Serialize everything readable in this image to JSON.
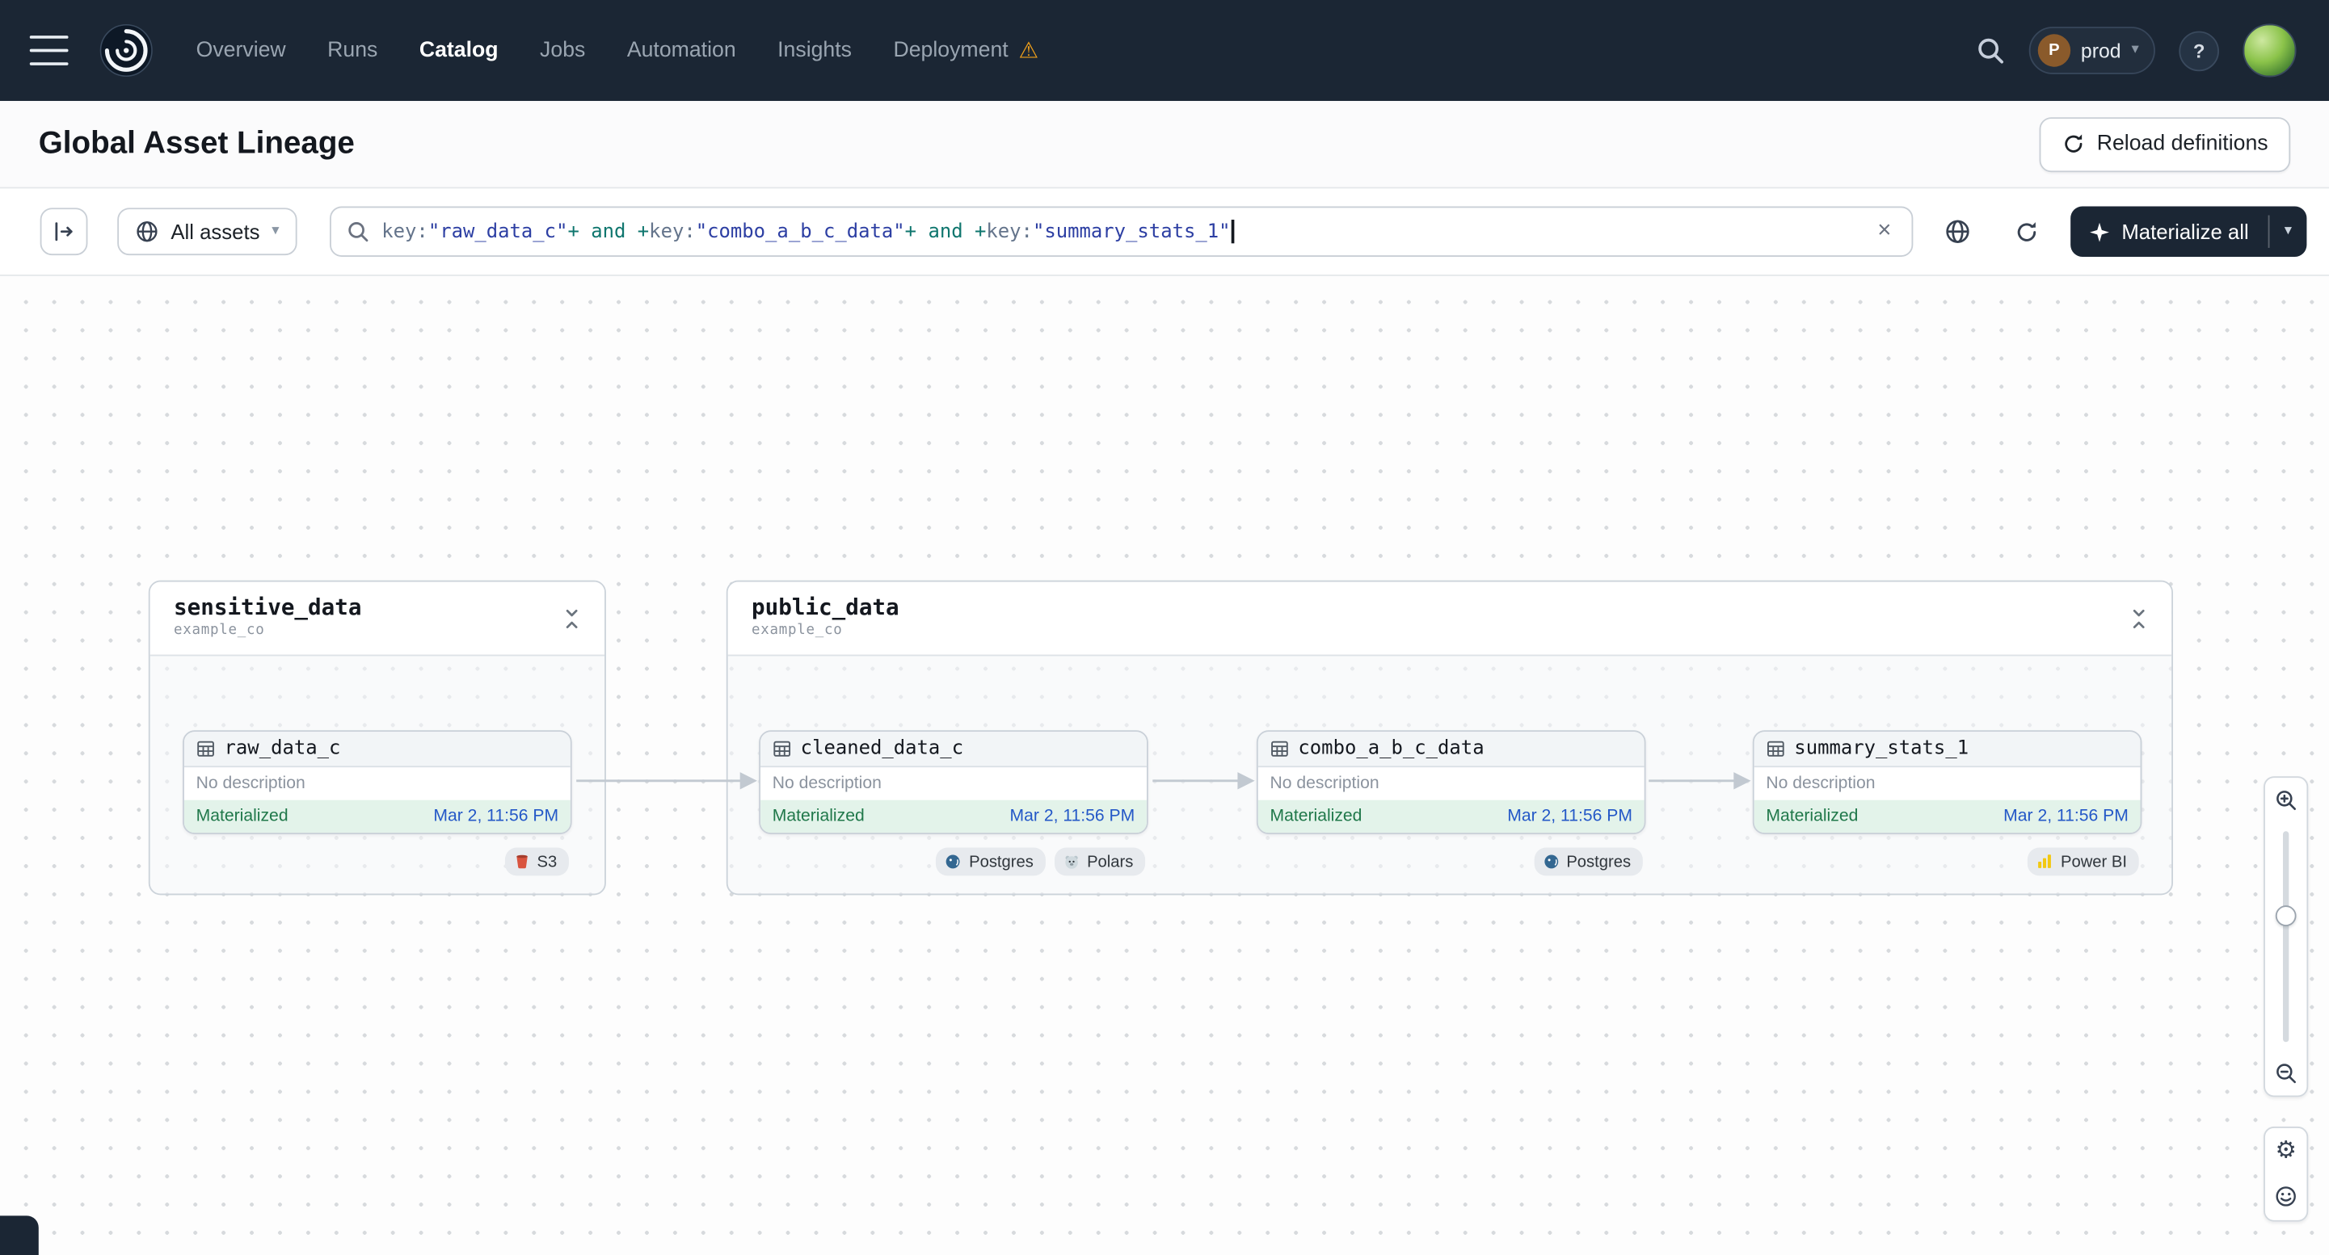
{
  "nav": {
    "items": [
      {
        "label": "Overview"
      },
      {
        "label": "Runs"
      },
      {
        "label": "Catalog"
      },
      {
        "label": "Jobs"
      },
      {
        "label": "Automation"
      },
      {
        "label": "Insights"
      },
      {
        "label": "Deployment"
      }
    ],
    "user_initial": "P",
    "deployment": "prod",
    "help_label": "?"
  },
  "icons": {
    "warning": "⚠",
    "chevron_down": "▾",
    "close": "×",
    "gear": "⚙"
  },
  "header": {
    "title": "Global Asset Lineage",
    "reload_label": "Reload definitions"
  },
  "toolbar": {
    "filter_label": "All assets",
    "materialize_label": "Materialize all",
    "query_tokens": [
      {
        "text": "key:",
        "type": "attribute"
      },
      {
        "text": "\"raw_data_c\"",
        "type": "value"
      },
      {
        "text": "+ and +",
        "type": "operator"
      },
      {
        "text": "key:",
        "type": "attribute"
      },
      {
        "text": "\"combo_a_b_c_data\"",
        "type": "value"
      },
      {
        "text": "+ and +",
        "type": "operator"
      },
      {
        "text": "key:",
        "type": "attribute"
      },
      {
        "text": "\"summary_stats_1\"",
        "type": "value"
      }
    ]
  },
  "graph": {
    "groups": [
      {
        "name": "sensitive_data",
        "subtitle": "example_co",
        "assets": [
          {
            "name": "raw_data_c",
            "description": "No description",
            "status": "Materialized",
            "timestamp": "Mar 2, 11:56 PM",
            "tags": [
              {
                "label": "S3"
              }
            ]
          }
        ]
      },
      {
        "name": "public_data",
        "subtitle": "example_co",
        "assets": [
          {
            "name": "cleaned_data_c",
            "description": "No description",
            "status": "Materialized",
            "timestamp": "Mar 2, 11:56 PM",
            "tags": [
              {
                "label": "Postgres"
              },
              {
                "label": "Polars"
              }
            ]
          },
          {
            "name": "combo_a_b_c_data",
            "description": "No description",
            "status": "Materialized",
            "timestamp": "Mar 2, 11:56 PM",
            "tags": [
              {
                "label": "Postgres"
              }
            ]
          },
          {
            "name": "summary_stats_1",
            "description": "No description",
            "status": "Materialized",
            "timestamp": "Mar 2, 11:56 PM",
            "tags": [
              {
                "label": "Power BI"
              }
            ]
          }
        ]
      }
    ]
  },
  "colors": {
    "nav_bg": "#1b2634",
    "status_green": "#20784a",
    "status_bg": "#e3f3ea",
    "timestamp_blue": "#2458c7",
    "warning_orange": "#f0a01a"
  }
}
